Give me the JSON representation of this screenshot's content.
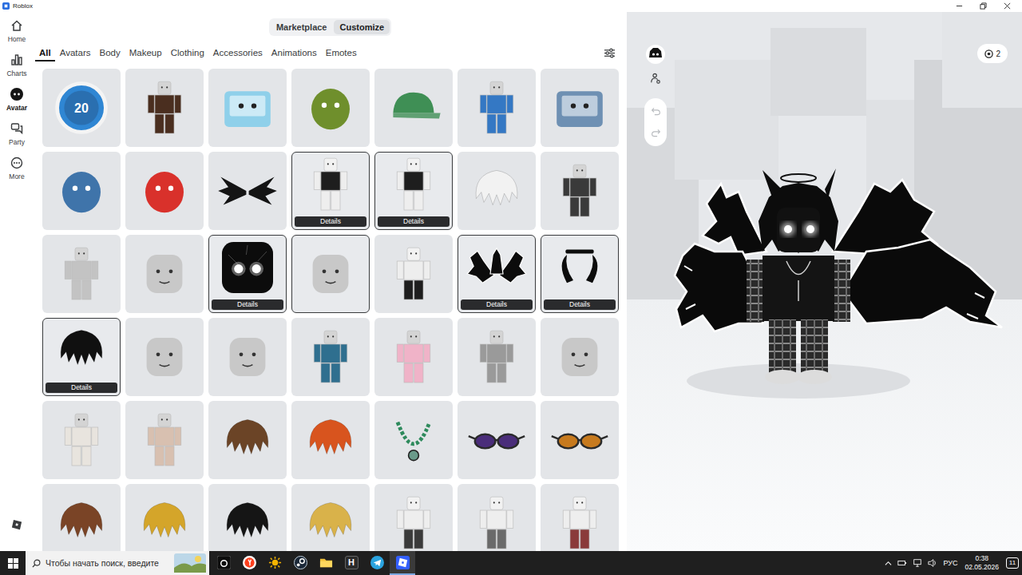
{
  "window": {
    "title": "Roblox"
  },
  "nav": {
    "items": [
      {
        "label": "Home",
        "selected": false
      },
      {
        "label": "Charts",
        "selected": false
      },
      {
        "label": "Avatar",
        "selected": true
      },
      {
        "label": "Party",
        "selected": false
      },
      {
        "label": "More",
        "selected": false
      }
    ]
  },
  "top_tabs": [
    {
      "label": "Marketplace",
      "selected": false
    },
    {
      "label": "Customize",
      "selected": true
    }
  ],
  "categories": [
    {
      "label": "All",
      "selected": true
    },
    {
      "label": "Avatars",
      "selected": false
    },
    {
      "label": "Body",
      "selected": false
    },
    {
      "label": "Makeup",
      "selected": false
    },
    {
      "label": "Clothing",
      "selected": false
    },
    {
      "label": "Accessories",
      "selected": false
    },
    {
      "label": "Animations",
      "selected": false
    },
    {
      "label": "Emotes",
      "selected": false
    }
  ],
  "grid": {
    "items": [
      {
        "kind": "coin",
        "color": "#2f86d3",
        "selected": false,
        "glyph": "20"
      },
      {
        "kind": "figure",
        "color": "#4a2e1f",
        "selected": false
      },
      {
        "kind": "box",
        "color": "#8fd0ea",
        "selected": false
      },
      {
        "kind": "blob",
        "color": "#6f8f2c",
        "selected": false
      },
      {
        "kind": "cap",
        "color": "#3f8f55",
        "selected": false
      },
      {
        "kind": "figure",
        "color": "#3478c4",
        "selected": false
      },
      {
        "kind": "box",
        "color": "#6e90b3",
        "selected": false
      },
      {
        "kind": "blob",
        "color": "#3f74aa",
        "selected": false
      },
      {
        "kind": "blob",
        "color": "#d9312b",
        "selected": false
      },
      {
        "kind": "wings",
        "color": "#141414",
        "selected": false
      },
      {
        "kind": "shirt",
        "color": "#1e1e1e",
        "selected": true,
        "details": "Details"
      },
      {
        "kind": "shirt",
        "color": "#1e1e1e",
        "selected": true,
        "details": "Details"
      },
      {
        "kind": "hair",
        "color": "#f2f2f2",
        "selected": false
      },
      {
        "kind": "figure",
        "color": "#3a3a3a",
        "selected": false
      },
      {
        "kind": "figure",
        "color": "#c3c3c3",
        "selected": false
      },
      {
        "kind": "head",
        "color": "#c8c8c8",
        "selected": false
      },
      {
        "kind": "glowhead",
        "color": "#0c0c0c",
        "selected": true,
        "details": "Details"
      },
      {
        "kind": "head",
        "color": "#c8c8c8",
        "selected": true
      },
      {
        "kind": "pants",
        "color": "#1e1e1e",
        "selected": false
      },
      {
        "kind": "dragons",
        "color": "#0c0c0c",
        "selected": true,
        "details": "Details"
      },
      {
        "kind": "horns",
        "color": "#0c0c0c",
        "selected": true,
        "details": "Details"
      },
      {
        "kind": "hair",
        "color": "#101010",
        "selected": true,
        "details": "Details"
      },
      {
        "kind": "head",
        "color": "#c8c8c8",
        "selected": false
      },
      {
        "kind": "head",
        "color": "#c8c8c8",
        "selected": false
      },
      {
        "kind": "figure",
        "color": "#2f6f8f",
        "selected": false
      },
      {
        "kind": "figure",
        "color": "#f0b3c8",
        "selected": false
      },
      {
        "kind": "figure",
        "color": "#9a9a9a",
        "selected": false
      },
      {
        "kind": "head",
        "color": "#c8c8c8",
        "selected": false
      },
      {
        "kind": "figure",
        "color": "#e8e4de",
        "selected": false
      },
      {
        "kind": "figure",
        "color": "#d8c0b0",
        "selected": false
      },
      {
        "kind": "hair",
        "color": "#6b4426",
        "selected": false
      },
      {
        "kind": "hair",
        "color": "#d8541e",
        "selected": false
      },
      {
        "kind": "necklace",
        "color": "#2e8a5c",
        "selected": false
      },
      {
        "kind": "glasses",
        "color": "#4a2d7a",
        "selected": false
      },
      {
        "kind": "glasses",
        "color": "#c77a1e",
        "selected": false
      },
      {
        "kind": "hair",
        "color": "#7a4426",
        "selected": false
      },
      {
        "kind": "hair",
        "color": "#d4a52a",
        "selected": false
      },
      {
        "kind": "hair",
        "color": "#151515",
        "selected": false
      },
      {
        "kind": "hair",
        "color": "#d9b24a",
        "selected": false
      },
      {
        "kind": "pants",
        "color": "#3a3a3a",
        "selected": false
      },
      {
        "kind": "pants",
        "color": "#6a6a6a",
        "selected": false
      },
      {
        "kind": "pants",
        "color": "#8a3a3a",
        "selected": false
      }
    ]
  },
  "viewport": {
    "badge": "2"
  },
  "taskbar": {
    "search": {
      "placeholder": "Чтобы начать поиск, введите"
    },
    "apps": [
      {
        "selected": false
      },
      {
        "selected": false
      },
      {
        "selected": false
      },
      {
        "selected": false
      },
      {
        "selected": false
      },
      {
        "selected": false,
        "glyph": "H"
      },
      {
        "selected": false
      },
      {
        "selected": true
      }
    ],
    "tray": {
      "language": "РУС",
      "time": "0:38",
      "date": "02.05.2026",
      "notifications": "11"
    }
  }
}
